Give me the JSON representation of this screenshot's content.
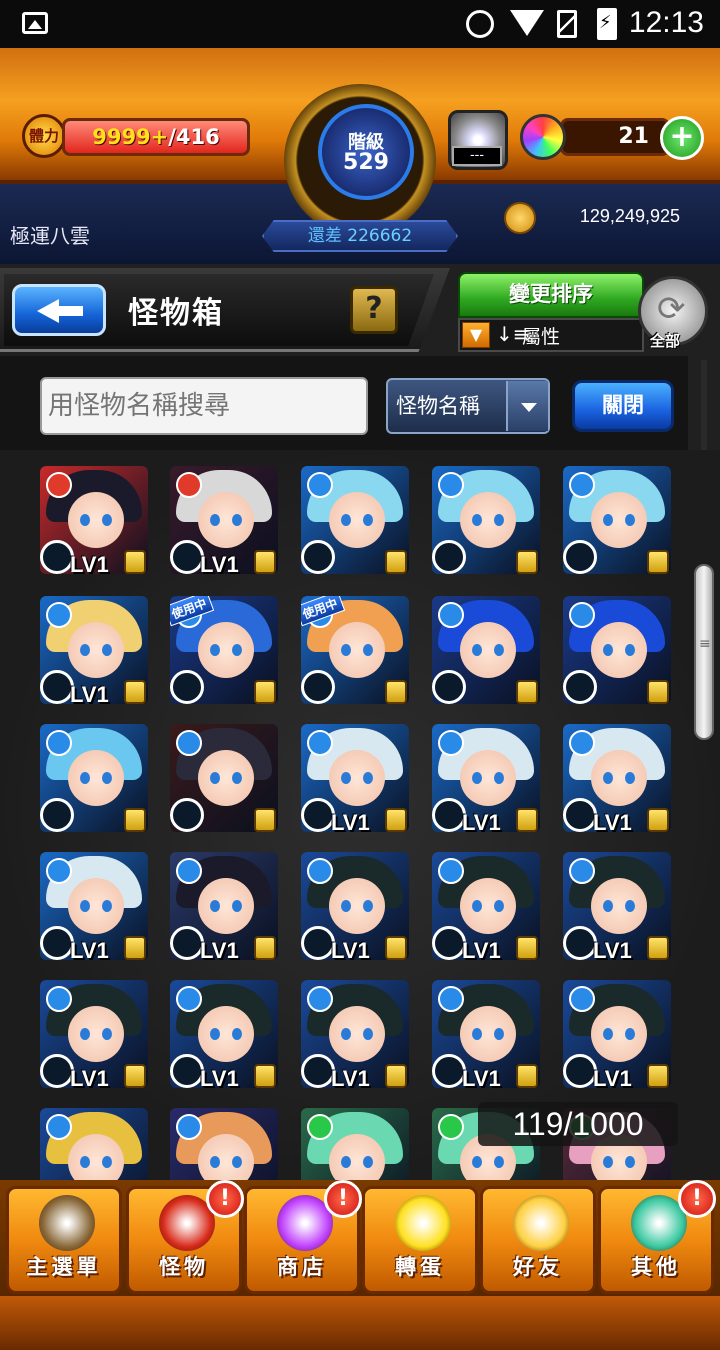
{
  "status_bar": {
    "time": "12:13"
  },
  "hud": {
    "stamina_label": "體力",
    "stamina_current": "9999+",
    "stamina_max": "/416",
    "stamina_fill": 1.0,
    "rank_label": "階級",
    "rank_value": "529",
    "rank_remain_label": "還差",
    "rank_remain_value": "226662",
    "lock_label": "---",
    "orbs": "21",
    "orb_add_label": "+",
    "player_name": "極運八雲",
    "gold": "129,249,925"
  },
  "header": {
    "title": "怪物箱",
    "help_label": "?",
    "sort_label": "變更排序",
    "sort_attribute": "屬性",
    "refresh_label": "全部"
  },
  "search": {
    "placeholder": "用怪物名稱搜尋",
    "select_value": "怪物名稱",
    "close_label": "關閉"
  },
  "grid": {
    "used_label": "使用中",
    "cards": [
      {
        "level": "LV1",
        "hair": "#1a1a2a",
        "bg": "#c82a2a",
        "el": "#e03a2a",
        "used": false
      },
      {
        "level": "LV1",
        "hair": "#d8d8d8",
        "bg": "#3a1a2a",
        "el": "#e03a2a",
        "used": false
      },
      {
        "level": "",
        "hair": "#8ad8f0",
        "bg": "#1a6ac8",
        "el": "#2a8ae8",
        "used": false
      },
      {
        "level": "",
        "hair": "#8ad8f0",
        "bg": "#1a6ac8",
        "el": "#2a8ae8",
        "used": false
      },
      {
        "level": "",
        "hair": "#8ad8f0",
        "bg": "#1a6ac8",
        "el": "#2a8ae8",
        "used": false
      },
      {
        "level": "LV1",
        "hair": "#f0d070",
        "bg": "#1a6ac8",
        "el": "#2a8ae8",
        "used": false
      },
      {
        "level": "",
        "hair": "#2a6ad8",
        "bg": "#1a3a8a",
        "el": "#2a8ae8",
        "used": true
      },
      {
        "level": "",
        "hair": "#f0a050",
        "bg": "#1a6ac8",
        "el": "#2a8ae8",
        "used": true
      },
      {
        "level": "",
        "hair": "#1a4ad8",
        "bg": "#1a3a8a",
        "el": "#2a8ae8",
        "used": false
      },
      {
        "level": "",
        "hair": "#1a4ad8",
        "bg": "#1a3a8a",
        "el": "#2a8ae8",
        "used": false
      },
      {
        "level": "",
        "hair": "#6ac8f0",
        "bg": "#1a6ac8",
        "el": "#2a8ae8",
        "used": false
      },
      {
        "level": "",
        "hair": "#2a2a3a",
        "bg": "#3a1a1a",
        "el": "#2a8ae8",
        "used": false
      },
      {
        "level": "LV1",
        "hair": "#d8e8f0",
        "bg": "#1a6ac8",
        "el": "#2a8ae8",
        "used": false
      },
      {
        "level": "LV1",
        "hair": "#d8e8f0",
        "bg": "#1a6ac8",
        "el": "#2a8ae8",
        "used": false
      },
      {
        "level": "LV1",
        "hair": "#d8e8f0",
        "bg": "#1a6ac8",
        "el": "#2a8ae8",
        "used": false
      },
      {
        "level": "LV1",
        "hair": "#d8e8f0",
        "bg": "#1a6ac8",
        "el": "#2a8ae8",
        "used": false
      },
      {
        "level": "LV1",
        "hair": "#1a1a2a",
        "bg": "#2a3a6a",
        "el": "#2a8ae8",
        "used": false
      },
      {
        "level": "LV1",
        "hair": "#1a2a2a",
        "bg": "#1a4a9a",
        "el": "#2a8ae8",
        "used": false
      },
      {
        "level": "LV1",
        "hair": "#1a2a2a",
        "bg": "#1a4a9a",
        "el": "#2a8ae8",
        "used": false
      },
      {
        "level": "LV1",
        "hair": "#1a2a2a",
        "bg": "#1a4a9a",
        "el": "#2a8ae8",
        "used": false
      },
      {
        "level": "LV1",
        "hair": "#1a2a2a",
        "bg": "#1a4a9a",
        "el": "#2a8ae8",
        "used": false
      },
      {
        "level": "LV1",
        "hair": "#1a2a2a",
        "bg": "#1a4a9a",
        "el": "#2a8ae8",
        "used": false
      },
      {
        "level": "LV1",
        "hair": "#1a2a2a",
        "bg": "#1a4a9a",
        "el": "#2a8ae8",
        "used": false
      },
      {
        "level": "LV1",
        "hair": "#1a2a2a",
        "bg": "#1a4a9a",
        "el": "#2a8ae8",
        "used": false
      },
      {
        "level": "LV1",
        "hair": "#1a2a2a",
        "bg": "#1a4a9a",
        "el": "#2a8ae8",
        "used": false
      },
      {
        "level": "",
        "hair": "#e8c040",
        "bg": "#1a4a9a",
        "el": "#2a8ae8",
        "used": false
      },
      {
        "level": "",
        "hair": "#e89a5a",
        "bg": "#2a2a6a",
        "el": "#2a8ae8",
        "used": false
      },
      {
        "level": "",
        "hair": "#6ad8b0",
        "bg": "#2a6a4a",
        "el": "#2ac84a",
        "used": false
      },
      {
        "level": "",
        "hair": "#6ad8b0",
        "bg": "#2a6a4a",
        "el": "#2ac84a",
        "used": false
      },
      {
        "level": "",
        "hair": "#e8a0c0",
        "bg": "#5a2a3a",
        "el": "#2ac84a",
        "used": false
      }
    ],
    "counter": "119/1000"
  },
  "nav": [
    {
      "label": "主選單",
      "badge": "",
      "color": "#8a6a3a"
    },
    {
      "label": "怪物",
      "badge": "!",
      "color": "#d82a1a"
    },
    {
      "label": "商店",
      "badge": "!",
      "color": "#c040ff"
    },
    {
      "label": "轉蛋",
      "badge": "",
      "color": "#ffe020"
    },
    {
      "label": "好友",
      "badge": "",
      "color": "#ffd040"
    },
    {
      "label": "其他",
      "badge": "!",
      "color": "#3ac8a0"
    }
  ]
}
